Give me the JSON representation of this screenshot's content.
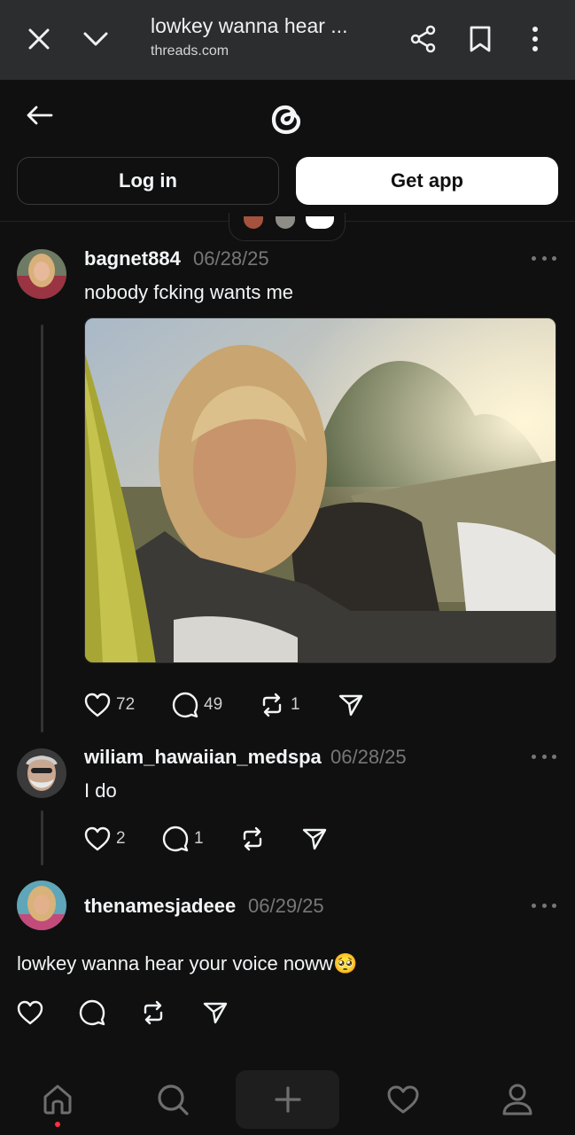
{
  "browser": {
    "title": "lowkey wanna hear ...",
    "domain": "threads.com"
  },
  "header": {
    "login_label": "Log in",
    "get_app_label": "Get app"
  },
  "posts": [
    {
      "username": "bagnet884",
      "date": "06/28/25",
      "text": "nobody fcking wants me",
      "likes": "72",
      "replies": "49",
      "reposts": "1",
      "has_image": true
    },
    {
      "username": "wiliam_hawaiian_medspa",
      "date": "06/28/25",
      "text": "I do",
      "likes": "2",
      "replies": "1",
      "reposts": ""
    },
    {
      "username": "thenamesjadeee",
      "date": "06/29/25",
      "text": "lowkey wanna hear your voice noww🥺"
    }
  ],
  "icons": {
    "close": "close-icon",
    "collapse": "chevron-down-icon",
    "share": "share-icon",
    "bookmark": "bookmark-icon",
    "menu": "kebab-menu-icon",
    "back": "arrow-left-icon",
    "logo": "threads-logo-icon",
    "nav": [
      "home-icon",
      "search-icon",
      "plus-icon",
      "heart-icon",
      "profile-icon"
    ]
  },
  "colors": {
    "background": "#101010",
    "browser_bar": "#2c2d2f",
    "muted_text": "#777777",
    "notification_dot": "#ff3040"
  }
}
